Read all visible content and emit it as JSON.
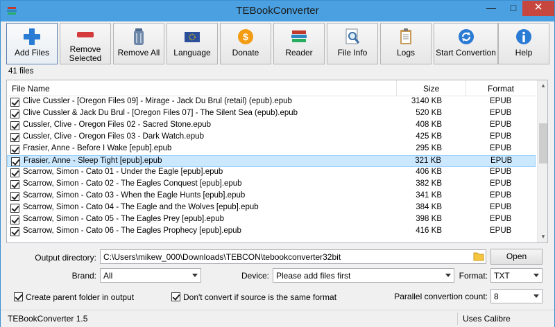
{
  "window": {
    "title": "TEBookConverter"
  },
  "toolbar": [
    {
      "label": "Add Files",
      "icon": "plus-icon"
    },
    {
      "label": "Remove Selected",
      "icon": "minus-icon"
    },
    {
      "label": "Remove All",
      "icon": "trash-icon"
    },
    {
      "label": "Language",
      "icon": "flag-icon"
    },
    {
      "label": "Donate",
      "icon": "coin-icon"
    },
    {
      "label": "Reader",
      "icon": "books-icon"
    },
    {
      "label": "File Info",
      "icon": "magnifier-icon"
    },
    {
      "label": "Logs",
      "icon": "clipboard-icon"
    },
    {
      "label": "Start Convertion",
      "icon": "refresh-icon"
    },
    {
      "label": "Help",
      "icon": "info-icon"
    }
  ],
  "file_count": "41 files",
  "list": {
    "headers": {
      "name": "File Name",
      "size": "Size",
      "format": "Format"
    },
    "rows": [
      {
        "name": "Clive Cussler - [Oregon Files 09] - Mirage - Jack Du Brul (retail) (epub).epub",
        "size": "3140 KB",
        "format": "EPUB"
      },
      {
        "name": "Clive Cussler & Jack Du Brul - [Oregon Files 07] - The Silent Sea (epub).epub",
        "size": "520 KB",
        "format": "EPUB"
      },
      {
        "name": "Cussler, Clive - Oregon Files 02 - Sacred Stone.epub",
        "size": "408 KB",
        "format": "EPUB"
      },
      {
        "name": "Cussler, Clive - Oregon Files 03 - Dark Watch.epub",
        "size": "425 KB",
        "format": "EPUB"
      },
      {
        "name": "Frasier, Anne - Before I Wake [epub].epub",
        "size": "295 KB",
        "format": "EPUB"
      },
      {
        "name": "Frasier, Anne - Sleep Tight [epub].epub",
        "size": "321 KB",
        "format": "EPUB"
      },
      {
        "name": "Scarrow, Simon - Cato 01 - Under the Eagle [epub].epub",
        "size": "406 KB",
        "format": "EPUB"
      },
      {
        "name": "Scarrow, Simon - Cato 02 - The Eagles Conquest [epub].epub",
        "size": "382 KB",
        "format": "EPUB"
      },
      {
        "name": "Scarrow, Simon - Cato 03 - When the Eagle Hunts [epub].epub",
        "size": "341 KB",
        "format": "EPUB"
      },
      {
        "name": "Scarrow, Simon - Cato 04 - The Eagle and the Wolves [epub].epub",
        "size": "384 KB",
        "format": "EPUB"
      },
      {
        "name": "Scarrow, Simon - Cato 05 - The Eagles Prey [epub].epub",
        "size": "398 KB",
        "format": "EPUB"
      },
      {
        "name": "Scarrow, Simon - Cato 06 - The Eagles Prophecy [epub].epub",
        "size": "416 KB",
        "format": "EPUB"
      }
    ],
    "selected_row_name": "Frasier, Anne - Sleep Tight [epub].epub"
  },
  "form": {
    "output_label": "Output directory:",
    "output_value": "C:\\Users\\mikew_000\\Downloads\\TEBCON\\tebookconverter32bit",
    "open_label": "Open",
    "brand_label": "Brand:",
    "brand_value": "All",
    "device_label": "Device:",
    "device_value": "Please add files first",
    "format_label": "Format:",
    "format_value": "TXT",
    "create_parent_label": "Create parent folder in output",
    "dont_convert_label": "Don't convert if source is the same format",
    "parallel_label": "Parallel convertion count:",
    "parallel_value": "8"
  },
  "status": {
    "left": "TEBookConverter 1.5",
    "right": "Uses Calibre"
  },
  "colors": {
    "titlebar": "#4aa0e0",
    "close": "#c7463e",
    "selection": "#cce8ff"
  }
}
